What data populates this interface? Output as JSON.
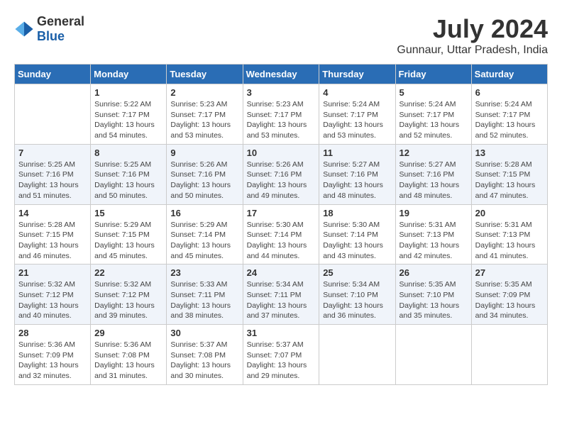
{
  "header": {
    "logo_general": "General",
    "logo_blue": "Blue",
    "month_year": "July 2024",
    "location": "Gunnaur, Uttar Pradesh, India"
  },
  "weekdays": [
    "Sunday",
    "Monday",
    "Tuesday",
    "Wednesday",
    "Thursday",
    "Friday",
    "Saturday"
  ],
  "weeks": [
    [
      {
        "day": "",
        "sunrise": "",
        "sunset": "",
        "daylight": ""
      },
      {
        "day": "1",
        "sunrise": "5:22 AM",
        "sunset": "7:17 PM",
        "daylight": "13 hours and 54 minutes."
      },
      {
        "day": "2",
        "sunrise": "5:23 AM",
        "sunset": "7:17 PM",
        "daylight": "13 hours and 53 minutes."
      },
      {
        "day": "3",
        "sunrise": "5:23 AM",
        "sunset": "7:17 PM",
        "daylight": "13 hours and 53 minutes."
      },
      {
        "day": "4",
        "sunrise": "5:24 AM",
        "sunset": "7:17 PM",
        "daylight": "13 hours and 53 minutes."
      },
      {
        "day": "5",
        "sunrise": "5:24 AM",
        "sunset": "7:17 PM",
        "daylight": "13 hours and 52 minutes."
      },
      {
        "day": "6",
        "sunrise": "5:24 AM",
        "sunset": "7:17 PM",
        "daylight": "13 hours and 52 minutes."
      }
    ],
    [
      {
        "day": "7",
        "sunrise": "5:25 AM",
        "sunset": "7:16 PM",
        "daylight": "13 hours and 51 minutes."
      },
      {
        "day": "8",
        "sunrise": "5:25 AM",
        "sunset": "7:16 PM",
        "daylight": "13 hours and 50 minutes."
      },
      {
        "day": "9",
        "sunrise": "5:26 AM",
        "sunset": "7:16 PM",
        "daylight": "13 hours and 50 minutes."
      },
      {
        "day": "10",
        "sunrise": "5:26 AM",
        "sunset": "7:16 PM",
        "daylight": "13 hours and 49 minutes."
      },
      {
        "day": "11",
        "sunrise": "5:27 AM",
        "sunset": "7:16 PM",
        "daylight": "13 hours and 48 minutes."
      },
      {
        "day": "12",
        "sunrise": "5:27 AM",
        "sunset": "7:16 PM",
        "daylight": "13 hours and 48 minutes."
      },
      {
        "day": "13",
        "sunrise": "5:28 AM",
        "sunset": "7:15 PM",
        "daylight": "13 hours and 47 minutes."
      }
    ],
    [
      {
        "day": "14",
        "sunrise": "5:28 AM",
        "sunset": "7:15 PM",
        "daylight": "13 hours and 46 minutes."
      },
      {
        "day": "15",
        "sunrise": "5:29 AM",
        "sunset": "7:15 PM",
        "daylight": "13 hours and 45 minutes."
      },
      {
        "day": "16",
        "sunrise": "5:29 AM",
        "sunset": "7:14 PM",
        "daylight": "13 hours and 45 minutes."
      },
      {
        "day": "17",
        "sunrise": "5:30 AM",
        "sunset": "7:14 PM",
        "daylight": "13 hours and 44 minutes."
      },
      {
        "day": "18",
        "sunrise": "5:30 AM",
        "sunset": "7:14 PM",
        "daylight": "13 hours and 43 minutes."
      },
      {
        "day": "19",
        "sunrise": "5:31 AM",
        "sunset": "7:13 PM",
        "daylight": "13 hours and 42 minutes."
      },
      {
        "day": "20",
        "sunrise": "5:31 AM",
        "sunset": "7:13 PM",
        "daylight": "13 hours and 41 minutes."
      }
    ],
    [
      {
        "day": "21",
        "sunrise": "5:32 AM",
        "sunset": "7:12 PM",
        "daylight": "13 hours and 40 minutes."
      },
      {
        "day": "22",
        "sunrise": "5:32 AM",
        "sunset": "7:12 PM",
        "daylight": "13 hours and 39 minutes."
      },
      {
        "day": "23",
        "sunrise": "5:33 AM",
        "sunset": "7:11 PM",
        "daylight": "13 hours and 38 minutes."
      },
      {
        "day": "24",
        "sunrise": "5:34 AM",
        "sunset": "7:11 PM",
        "daylight": "13 hours and 37 minutes."
      },
      {
        "day": "25",
        "sunrise": "5:34 AM",
        "sunset": "7:10 PM",
        "daylight": "13 hours and 36 minutes."
      },
      {
        "day": "26",
        "sunrise": "5:35 AM",
        "sunset": "7:10 PM",
        "daylight": "13 hours and 35 minutes."
      },
      {
        "day": "27",
        "sunrise": "5:35 AM",
        "sunset": "7:09 PM",
        "daylight": "13 hours and 34 minutes."
      }
    ],
    [
      {
        "day": "28",
        "sunrise": "5:36 AM",
        "sunset": "7:09 PM",
        "daylight": "13 hours and 32 minutes."
      },
      {
        "day": "29",
        "sunrise": "5:36 AM",
        "sunset": "7:08 PM",
        "daylight": "13 hours and 31 minutes."
      },
      {
        "day": "30",
        "sunrise": "5:37 AM",
        "sunset": "7:08 PM",
        "daylight": "13 hours and 30 minutes."
      },
      {
        "day": "31",
        "sunrise": "5:37 AM",
        "sunset": "7:07 PM",
        "daylight": "13 hours and 29 minutes."
      },
      {
        "day": "",
        "sunrise": "",
        "sunset": "",
        "daylight": ""
      },
      {
        "day": "",
        "sunrise": "",
        "sunset": "",
        "daylight": ""
      },
      {
        "day": "",
        "sunrise": "",
        "sunset": "",
        "daylight": ""
      }
    ]
  ]
}
